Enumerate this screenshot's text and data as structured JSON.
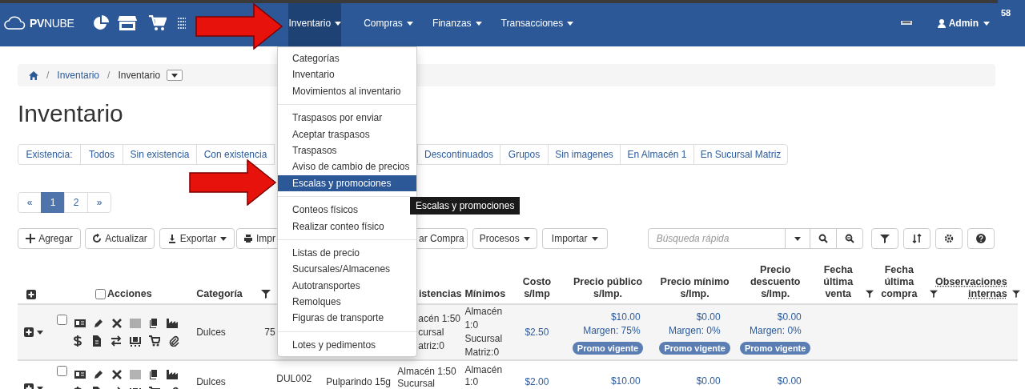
{
  "navbar": {
    "brand_bold": "PV",
    "brand": "NUBE",
    "menus": [
      {
        "label": "Inventario",
        "expanded": true
      },
      {
        "label": "Compras",
        "expanded": false
      },
      {
        "label": "Finanzas",
        "expanded": false
      },
      {
        "label": "Transacciones",
        "expanded": false
      }
    ],
    "user": "Admin",
    "badge": "58"
  },
  "inventory_menu": {
    "groups": [
      [
        {
          "label": "Categorías",
          "selected": false
        },
        {
          "label": "Inventario",
          "selected": false
        },
        {
          "label": "Movimientos al inventario",
          "selected": false
        }
      ],
      [
        {
          "label": "Traspasos por enviar",
          "selected": false
        },
        {
          "label": "Aceptar traspasos",
          "selected": false
        },
        {
          "label": "Traspasos",
          "selected": false
        },
        {
          "label": "Aviso de cambio de precios",
          "selected": false
        },
        {
          "label": "Escalas y promociones",
          "selected": true
        }
      ],
      [
        {
          "label": "Conteos físicos",
          "selected": false
        },
        {
          "label": "Realizar conteo físico",
          "selected": false
        }
      ],
      [
        {
          "label": "Listas de precio",
          "selected": false
        },
        {
          "label": "Sucursales/Almacenes",
          "selected": false
        },
        {
          "label": "Autotransportes",
          "selected": false
        },
        {
          "label": "Remolques",
          "selected": false
        },
        {
          "label": "Figuras de transporte",
          "selected": false
        }
      ],
      [
        {
          "label": "Lotes y pedimentos",
          "selected": false
        }
      ]
    ]
  },
  "tooltip": "Escalas y promociones",
  "breadcrumb": {
    "separator": "/",
    "items": [
      "Inventario",
      "Inventario"
    ]
  },
  "title": "Inventario",
  "filters": {
    "label": "Existencia:",
    "left": [
      "Todos",
      "Sin existencia",
      "Con existencia"
    ],
    "right": [
      "Descontinuados",
      "Grupos",
      "Sin imagenes",
      "En Almacén 1",
      "En Sucursal Matriz"
    ]
  },
  "pagination": [
    {
      "label": "«",
      "selected": false
    },
    {
      "label": "1",
      "selected": true
    },
    {
      "label": "2",
      "selected": false
    },
    {
      "label": "»",
      "selected": false
    }
  ],
  "toolbar": {
    "left": [
      {
        "label": "Agregar",
        "dropdown": false
      },
      {
        "label": "Actualizar",
        "dropdown": false
      },
      {
        "label": "Exportar",
        "dropdown": true
      },
      {
        "label": "Impr"
      }
    ],
    "right": [
      {
        "label": "ar Compra",
        "dropdown": false
      },
      {
        "label": "Procesos",
        "dropdown": true
      },
      {
        "label": "Importar",
        "dropdown": true
      }
    ],
    "search": {
      "placeholder": "Búsqueda rápida"
    }
  },
  "table": {
    "select_all": {
      "checked": false
    },
    "columns": [
      {
        "label": "Acciones",
        "filter": false,
        "kind": "text"
      },
      {
        "label": "Categoría",
        "filter": true,
        "kind": "text"
      },
      {
        "label": "istencias",
        "filter": false,
        "kind": "text"
      },
      {
        "label": "Mínimos",
        "filter": false,
        "kind": "text"
      },
      {
        "label": "Costo s/Imp",
        "filter": false,
        "kind": "text"
      },
      {
        "label": "Precio público s/Imp.",
        "filter": false,
        "kind": "text"
      },
      {
        "label": "Precio mínimo s/Imp.",
        "filter": false,
        "kind": "text"
      },
      {
        "label": "Precio descuento s/Imp.",
        "filter": false,
        "kind": "text"
      },
      {
        "label": "Fecha última venta",
        "filter": true,
        "kind": "text"
      },
      {
        "label": "Fecha última compra",
        "filter": true,
        "kind": "text"
      },
      {
        "label": "Observaciones internas",
        "filter": true,
        "kind": "abbr"
      }
    ],
    "rows": [
      {
        "checked": false,
        "category": "Dulces",
        "code": "75",
        "stock": [
          "acén 1:50",
          "cursal",
          "atriz:0"
        ],
        "minimums": [
          "Almacén",
          "1:0",
          "Sucursal",
          "Matriz:0"
        ],
        "cost": "$2.50",
        "prices": [
          {
            "price": "$10.00",
            "margin": "Margen: 75%",
            "promo": "Promo vigente"
          },
          {
            "price": "$0.00",
            "margin": "Margen: 0%",
            "promo": "Promo vigente"
          },
          {
            "price": "$0.00",
            "margin": "Margen: 0%",
            "promo": "Promo vigente"
          }
        ]
      },
      {
        "checked": false,
        "category": "Dulces",
        "code": "DUL002",
        "description": "Pulparindo 15g",
        "stock": [
          "Almacén 1:50",
          "Sucursal"
        ],
        "minimums": [
          "Almacén",
          "1:0"
        ],
        "cost": "$2.00",
        "prices": [
          {
            "price": "$10.00"
          },
          {
            "price": "$0.00"
          },
          {
            "price": "$0.00"
          }
        ]
      }
    ]
  }
}
